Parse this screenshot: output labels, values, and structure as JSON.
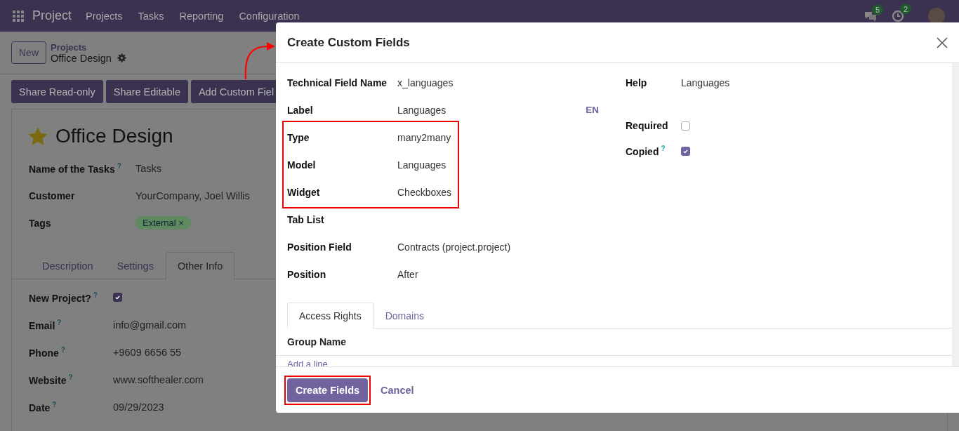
{
  "navbar": {
    "app_name": "Project",
    "menu": [
      "Projects",
      "Tasks",
      "Reporting",
      "Configuration"
    ],
    "messages_count": "5",
    "activities_count": "2"
  },
  "control_panel": {
    "new_button": "New",
    "breadcrumb_parent": "Projects",
    "breadcrumb_current": "Office Design"
  },
  "actions": [
    "Share Read-only",
    "Share Editable",
    "Add Custom Fiel"
  ],
  "record": {
    "title": "Office Design",
    "starred": true,
    "fields": [
      {
        "label": "Name of the Tasks",
        "help": "?",
        "kind": "text",
        "value": "Tasks"
      },
      {
        "label": "Customer",
        "kind": "text",
        "value": "YourCompany, Joel Willis"
      },
      {
        "label": "Tags",
        "kind": "tags",
        "tags": [
          {
            "label": "External",
            "remove": "×"
          }
        ]
      }
    ],
    "tabs": [
      {
        "label": "Description",
        "selected": false
      },
      {
        "label": "Settings",
        "selected": false
      },
      {
        "label": "Other Info",
        "selected": true
      }
    ],
    "other_info": [
      {
        "label": "New Project?",
        "help": "?",
        "kind": "checkbox",
        "checked": true
      },
      {
        "label": "Email",
        "help": "?",
        "kind": "text",
        "value": "info@gmail.com"
      },
      {
        "label": "Phone",
        "help": "?",
        "kind": "text",
        "value": "+9609 6656 55"
      },
      {
        "label": "Website",
        "help": "?",
        "kind": "text",
        "value": "www.softhealer.com"
      },
      {
        "label": "Date",
        "help": "?",
        "kind": "text",
        "value": "09/29/2023"
      }
    ]
  },
  "dialog": {
    "title": "Create Custom Fields",
    "fields": [
      {
        "label": "Technical Field Name",
        "value": "x_languages",
        "highlighted": false
      },
      {
        "label": "Label",
        "value": "Languages",
        "lang": "EN",
        "highlighted": false
      },
      {
        "label": "Type",
        "value": "many2many",
        "highlighted": true
      },
      {
        "label": "Model",
        "value": "Languages",
        "highlighted": true
      },
      {
        "label": "Widget",
        "value": "Checkboxes",
        "highlighted": true
      },
      {
        "label": "Tab List",
        "highlighted": false
      },
      {
        "label": "Position Field",
        "value": "Contracts (project.project)",
        "highlighted": false
      },
      {
        "label": "Position",
        "value": "After",
        "highlighted": false
      }
    ],
    "side_fields": [
      {
        "label": "Help",
        "kind": "text",
        "value": "Languages"
      },
      {
        "label": "Required",
        "kind": "checkbox",
        "checked": false
      },
      {
        "label": "Copied",
        "help": "?",
        "kind": "checkbox",
        "checked": true
      }
    ],
    "tabs": [
      {
        "label": "Access Rights",
        "selected": true
      },
      {
        "label": "Domains",
        "selected": false
      }
    ],
    "table": {
      "columns": [
        "Group Name"
      ],
      "add_line": "Add a line"
    },
    "buttons": [
      {
        "label": "Create Fields",
        "kind": "primary",
        "highlighted": true
      },
      {
        "label": "Cancel",
        "kind": "link",
        "highlighted": false
      }
    ]
  }
}
